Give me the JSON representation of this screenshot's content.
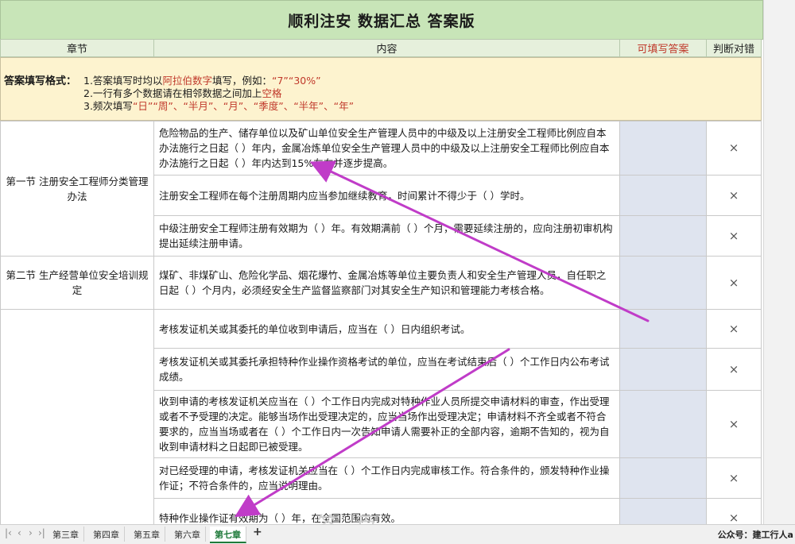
{
  "title": "顺利注安  数据汇总  答案版",
  "headers": {
    "section": "章节",
    "content": "内容",
    "answer": "可填写答案",
    "judge": "判断对错"
  },
  "format": {
    "lead": "答案填写格式：",
    "line1_a": "1.答案填写时均以",
    "line1_b": "阿拉伯数字",
    "line1_c": "填写，例如：",
    "line1_d": "“7”“30%”",
    "line2_a": "2.一行有多个数据请在相邻数据之间加上",
    "line2_b": "空格",
    "line3_a": "3.频次填写",
    "line3_b": "“日”“周”、“半月”、“月”、“季度”、“半年”、“年”"
  },
  "sections": {
    "s1": "第一节  注册安全工程师分类管理办法",
    "s2": "第二节  生产经营单位安全培训规定",
    "s3": ""
  },
  "rows": [
    {
      "content": "危险物品的生产、储存单位以及矿山单位安全生产管理人员中的中级及以上注册安全工程师比例应自本办法施行之日起（ ）年内，金属冶炼单位安全生产管理人员中的中级及以上注册安全工程师比例应自本办法施行之日起（ ）年内达到15%左右并逐步提高。",
      "judge": "×"
    },
    {
      "content": "注册安全工程师在每个注册周期内应当参加继续教育，时间累计不得少于（ ）学时。",
      "judge": "×"
    },
    {
      "content": "中级注册安全工程师注册有效期为（ ）年。有效期满前（ ）个月，需要延续注册的，应向注册初审机构提出延续注册申请。",
      "judge": "×"
    },
    {
      "content": "煤矿、非煤矿山、危险化学品、烟花爆竹、金属冶炼等单位主要负责人和安全生产管理人员，自任职之日起（ ）个月内，必须经安全生产监督监察部门对其安全生产知识和管理能力考核合格。",
      "judge": "×"
    },
    {
      "content": "考核发证机关或其委托的单位收到申请后，应当在（ ）日内组织考试。",
      "judge": "×"
    },
    {
      "content": "考核发证机关或其委托承担特种作业操作资格考试的单位，应当在考试结束后（ ）个工作日内公布考试成绩。",
      "judge": "×"
    },
    {
      "content": "收到申请的考核发证机关应当在（ ）个工作日内完成对特种作业人员所提交申请材料的审查，作出受理或者不予受理的决定。能够当场作出受理决定的，应当当场作出受理决定；申请材料不齐全或者不符合要求的，应当当场或者在（ ）个工作日内一次告知申请人需要补正的全部内容，逾期不告知的，视为自收到申请材料之日起即已被受理。",
      "judge": "×"
    },
    {
      "content": "对已经受理的申请，考核发证机关应当在（ ）个工作日内完成审核工作。符合条件的，颁发特种作业操作证；不符合条件的，应当说明理由。",
      "judge": "×"
    },
    {
      "content": "特种作业操作证有效期为（ ）年，在全国范围内有效。",
      "judge": "×"
    }
  ],
  "tabs": [
    "第三章",
    "第四章",
    "第五章",
    "第六章",
    "第七章"
  ],
  "active_tab": "第七章",
  "add_tab": "+",
  "watermark": "公众号：建工行人a",
  "faint_text": "答   百",
  "colors": {
    "title_bg": "#c8e5b8",
    "format_bg": "#fdf3cf",
    "answer_bg": "#dfe4ef",
    "arrow": "#c03cc8"
  }
}
